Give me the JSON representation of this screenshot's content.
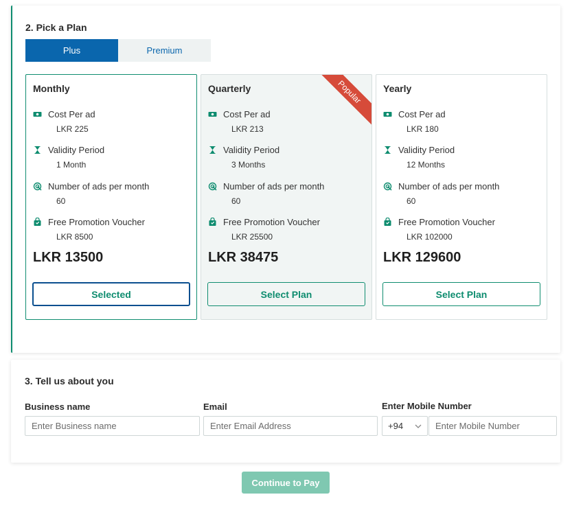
{
  "pick_plan": {
    "title": "2. Pick a Plan",
    "tabs": [
      {
        "label": "Plus",
        "active": true
      },
      {
        "label": "Premium",
        "active": false
      }
    ],
    "plans": [
      {
        "name": "Monthly",
        "features": [
          {
            "label": "Cost Per ad",
            "value": "LKR 225",
            "icon": "money-icon"
          },
          {
            "label": "Validity Period",
            "value": "1 Month",
            "icon": "hourglass-icon"
          },
          {
            "label": "Number of ads per month",
            "value": "60",
            "icon": "target-icon"
          },
          {
            "label": "Free Promotion Voucher",
            "value": "LKR 8500",
            "icon": "bag-icon"
          }
        ],
        "price": "LKR 13500",
        "button": "Selected"
      },
      {
        "name": "Quarterly",
        "ribbon": "Popular",
        "features": [
          {
            "label": "Cost Per ad",
            "value": "LKR 213",
            "icon": "money-icon"
          },
          {
            "label": "Validity Period",
            "value": "3 Months",
            "icon": "hourglass-icon"
          },
          {
            "label": "Number of ads per month",
            "value": "60",
            "icon": "target-icon"
          },
          {
            "label": "Free Promotion Voucher",
            "value": "LKR 25500",
            "icon": "bag-icon"
          }
        ],
        "price": "LKR 38475",
        "button": "Select Plan"
      },
      {
        "name": "Yearly",
        "features": [
          {
            "label": "Cost Per ad",
            "value": "LKR 180",
            "icon": "money-icon"
          },
          {
            "label": "Validity Period",
            "value": "12 Months",
            "icon": "hourglass-icon"
          },
          {
            "label": "Number of ads per month",
            "value": "60",
            "icon": "target-icon"
          },
          {
            "label": "Free Promotion Voucher",
            "value": "LKR 102000",
            "icon": "bag-icon"
          }
        ],
        "price": "LKR 129600",
        "button": "Select Plan"
      }
    ]
  },
  "about_you": {
    "title": "3. Tell us about you",
    "business": {
      "label": "Business name",
      "placeholder": "Enter Business name"
    },
    "email": {
      "label": "Email",
      "placeholder": "Enter Email Address"
    },
    "mobile": {
      "label": "Enter Mobile Number",
      "prefix": "+94",
      "placeholder": "Enter Mobile Number"
    }
  },
  "continue_label": "Continue to Pay",
  "colors": {
    "accent_green": "#0e8c6f",
    "tab_blue": "#0a66ad",
    "ribbon_red": "#d64b3a",
    "continue_disabled": "#7fc8b1"
  }
}
